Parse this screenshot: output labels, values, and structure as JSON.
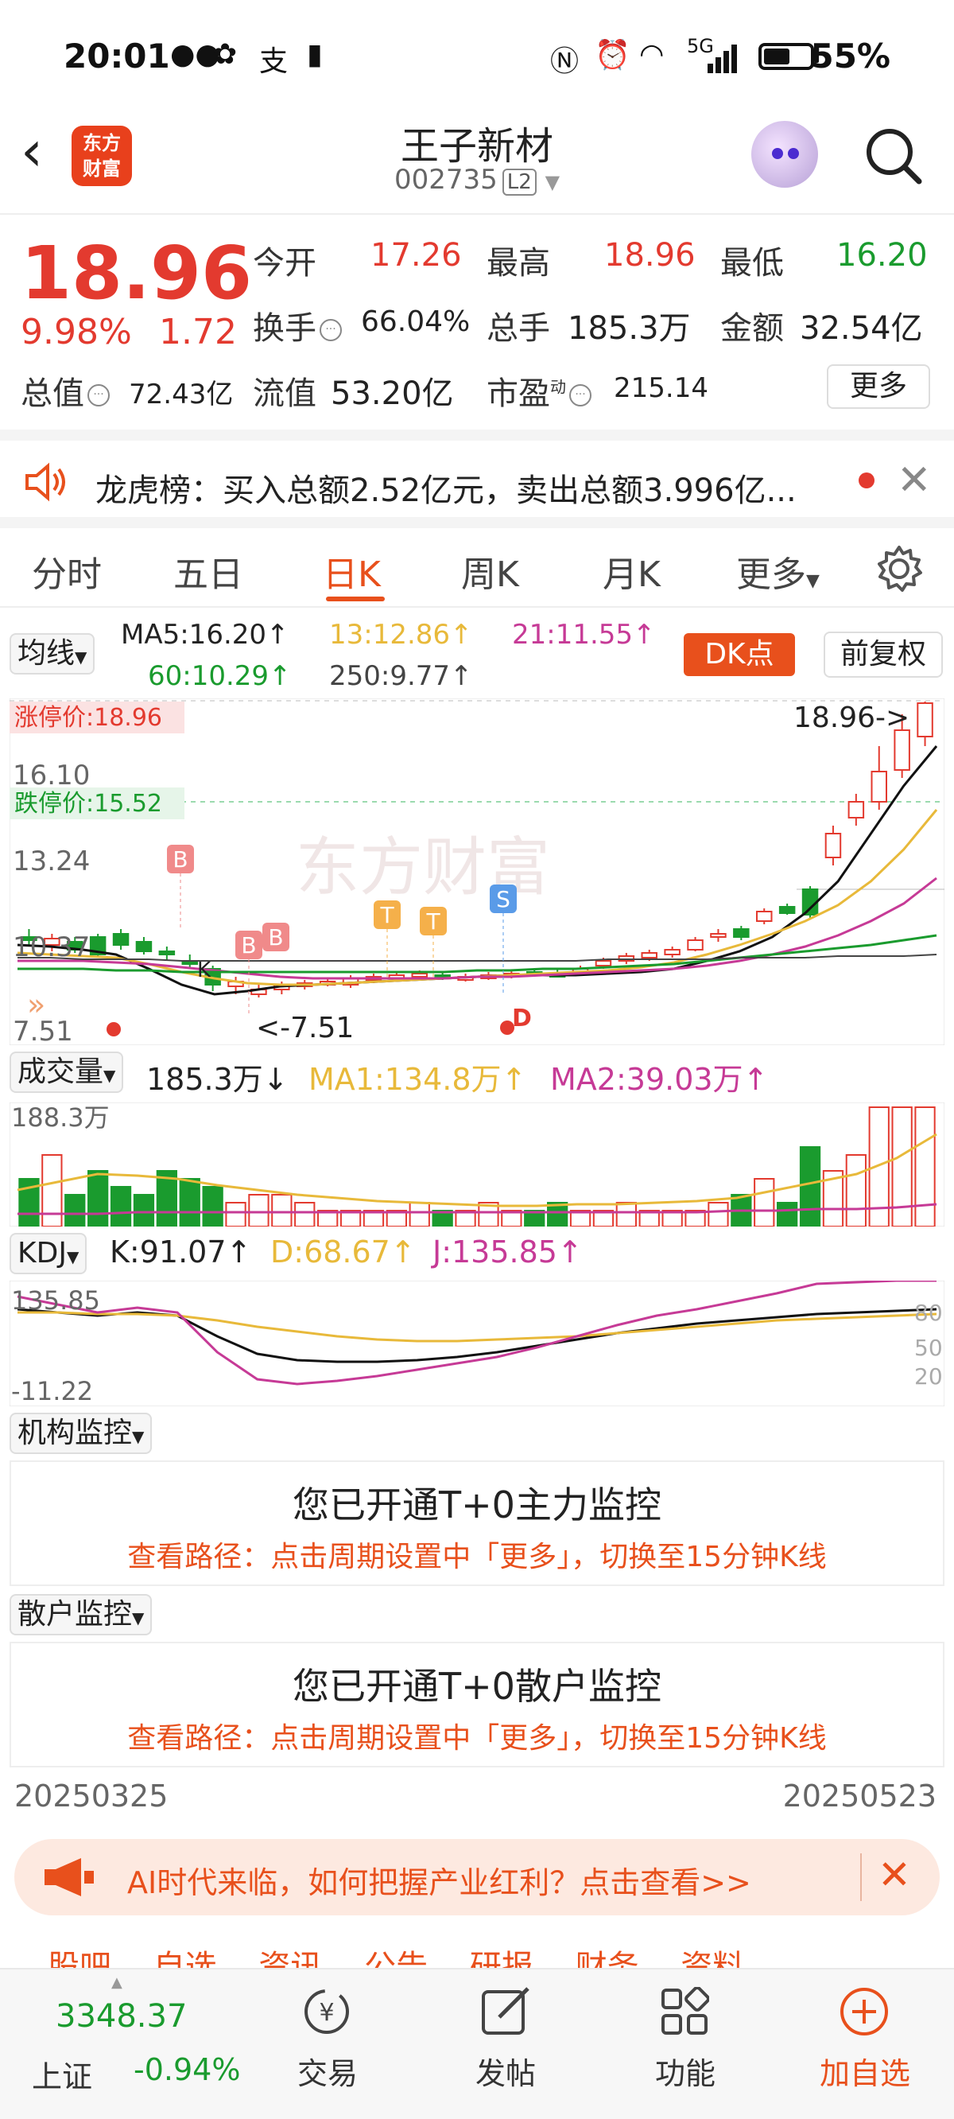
{
  "status_bar": {
    "time": "20:01",
    "battery_pct": "55%",
    "network": "5G"
  },
  "header": {
    "logo_line1": "东方",
    "logo_line2": "财富",
    "stock_name": "王子新材",
    "stock_code": "002735",
    "level_badge": "L2"
  },
  "quote": {
    "price": "18.96",
    "change_pct": "9.98%",
    "change_amt": "1.72",
    "open_label": "今开",
    "open": "17.26",
    "high_label": "最高",
    "high": "18.96",
    "low_label": "最低",
    "low": "16.20",
    "turnover_label": "换手",
    "turnover": "66.04%",
    "volume_label": "总手",
    "volume": "185.3万",
    "amount_label": "金额",
    "amount": "32.54亿",
    "mktcap_label": "总值",
    "mktcap": "72.43亿",
    "float_label": "流值",
    "float_cap": "53.20亿",
    "pe_label": "市盈",
    "pe_sup": "动",
    "pe": "215.14",
    "more": "更多"
  },
  "notice": {
    "text": "龙虎榜：买入总额2.52亿元，卖出总额3.996亿..."
  },
  "tabs": [
    "分时",
    "五日",
    "日K",
    "周K",
    "月K",
    "更多"
  ],
  "active_tab": "日K",
  "ma_row": {
    "selector": "均线",
    "ma5": "MA5:16.20↑",
    "ma13": "13:12.86↑",
    "ma21": "21:11.55↑",
    "ma60": "60:10.29↑",
    "ma250": "250:9.77↑",
    "dk_button": "DK点",
    "fq_button": "前复权"
  },
  "kline": {
    "limit_up": "涨停价:18.96",
    "limit_down": "跌停价:15.52",
    "y_labels": [
      "16.10",
      "13.24",
      "10.37",
      "7.51"
    ],
    "max_marker": "18.96->",
    "min_marker": "<-7.51",
    "watermark": "东方财富",
    "markers": [
      "B",
      "B",
      "B",
      "T",
      "T",
      "S",
      "D",
      "K"
    ]
  },
  "volume": {
    "selector": "成交量",
    "value": "185.3万↓",
    "ma1": "MA1:134.8万↑",
    "ma2": "MA2:39.03万↑",
    "y_label": "188.3万"
  },
  "kdj": {
    "selector": "KDJ",
    "k": "K:91.07↑",
    "d": "D:68.67↑",
    "j": "J:135.85↑",
    "y_top": "135.85",
    "y_bottom": "-11.22",
    "levels": [
      "80",
      "50",
      "20"
    ]
  },
  "inst_monitor": {
    "selector": "机构监控",
    "title": "您已开通T+0主力监控",
    "path": "查看路径：点击周期设置中「更多」，切换至15分钟K线"
  },
  "retail_monitor": {
    "selector": "散户监控",
    "title": "您已开通T+0散户监控",
    "path": "查看路径：点击周期设置中「更多」，切换至15分钟K线"
  },
  "dates": {
    "start": "20250325",
    "end": "20250523"
  },
  "ad": {
    "text": "AI时代来临，如何把握产业红利？点击查看>>"
  },
  "cover_tabs": "股吧   自选   资讯   公告   研报   财务   资料",
  "bottom_nav": {
    "index_value": "3348.37",
    "index_name": "上证",
    "index_change": "-0.94%",
    "items": [
      "交易",
      "发帖",
      "功能",
      "加自选"
    ]
  },
  "colors": {
    "up": "#e33a2f",
    "down": "#1a9b2e",
    "accent": "#e8501c"
  }
}
